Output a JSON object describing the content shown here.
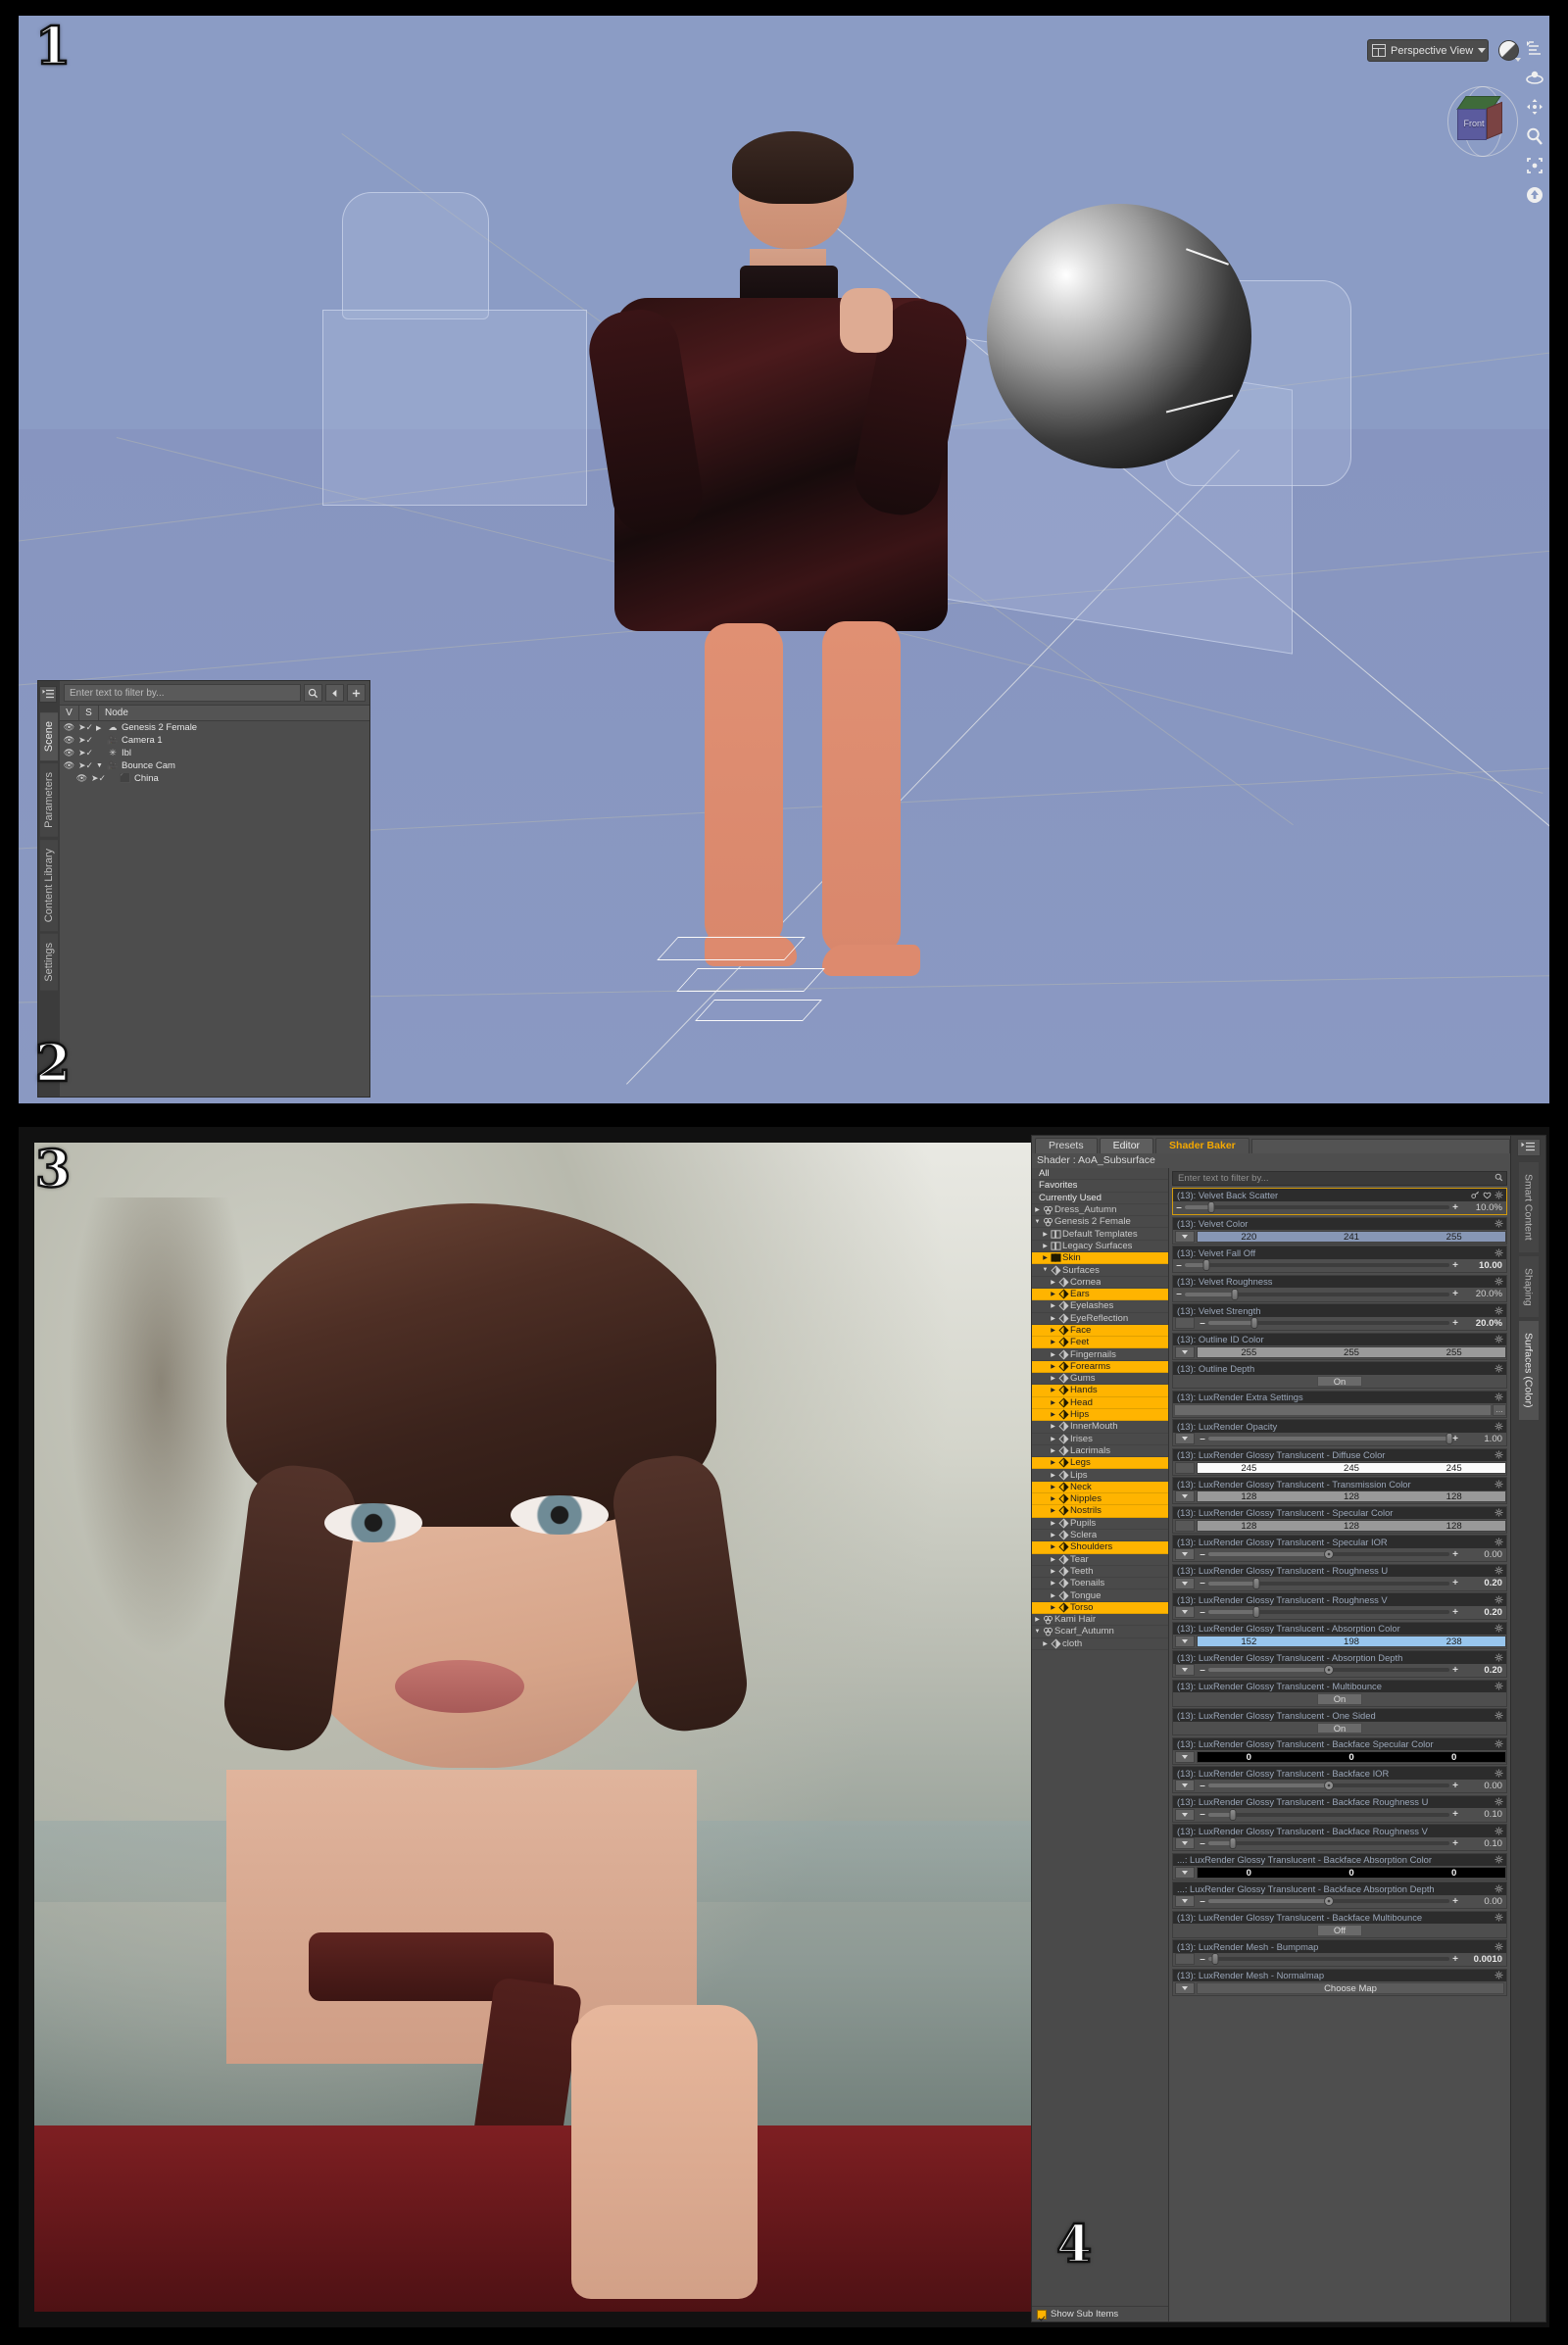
{
  "badges": {
    "b1": "1",
    "b2": "2",
    "b3": "3",
    "b4": "4"
  },
  "viewport": {
    "view_selector": "Perspective View",
    "cube_face": "Front",
    "tools": [
      "view-mode-icon",
      "orbit-icon",
      "pan-icon",
      "zoom-icon",
      "frame-icon",
      "reset-view-icon"
    ]
  },
  "scene_pane": {
    "tabs": [
      {
        "label": "Scene",
        "active": true
      },
      {
        "label": "Parameters",
        "active": false
      },
      {
        "label": "Content Library",
        "active": false
      },
      {
        "label": "Settings",
        "active": false
      }
    ],
    "filter_placeholder": "Enter text to filter by...",
    "columns": [
      "V",
      "S",
      "Node"
    ],
    "nodes": [
      {
        "name": "Genesis 2 Female",
        "icon": "figure-icon",
        "indent": 0,
        "expander": "▶"
      },
      {
        "name": "Camera 1",
        "icon": "camera-icon",
        "indent": 0,
        "expander": ""
      },
      {
        "name": "Ibl",
        "icon": "light-icon",
        "indent": 0,
        "expander": ""
      },
      {
        "name": "Bounce Cam",
        "icon": "camera-icon",
        "indent": 0,
        "expander": "▼"
      },
      {
        "name": "China",
        "icon": "cube-icon",
        "indent": 1,
        "expander": ""
      }
    ]
  },
  "surfaces": {
    "tabs": [
      {
        "label": "Presets",
        "state": "normal"
      },
      {
        "label": "Editor",
        "state": "active"
      },
      {
        "label": "Shader Baker",
        "state": "accent"
      }
    ],
    "shader_line": "Shader : AoA_Subsurface",
    "filter_placeholder": "Enter text to filter by...",
    "show_sub_items_label": "Show Sub Items",
    "show_sub_items_checked": true,
    "selected_color": "#ffb400",
    "tree": [
      {
        "label": "All",
        "type": "head",
        "depth": 0,
        "expander": "",
        "selected": false
      },
      {
        "label": "Favorites",
        "type": "head",
        "depth": 0,
        "expander": "",
        "selected": false
      },
      {
        "label": "Currently Used",
        "type": "head",
        "depth": 0,
        "expander": "",
        "selected": false
      },
      {
        "label": "Dress_Autumn",
        "type": "figure",
        "depth": 0,
        "expander": "▶",
        "selected": false
      },
      {
        "label": "Genesis 2 Female",
        "type": "figure",
        "depth": 0,
        "expander": "▼",
        "selected": false
      },
      {
        "label": "Default Templates",
        "type": "group",
        "depth": 1,
        "expander": "▶",
        "selected": false
      },
      {
        "label": "Legacy Surfaces",
        "type": "group",
        "depth": 1,
        "expander": "▶",
        "selected": false
      },
      {
        "label": "Skin",
        "type": "group",
        "depth": 1,
        "expander": "▶",
        "selected": true
      },
      {
        "label": "Surfaces",
        "type": "surf",
        "depth": 1,
        "expander": "▼",
        "selected": false
      },
      {
        "label": "Cornea",
        "type": "surf",
        "depth": 2,
        "expander": "▶",
        "selected": false
      },
      {
        "label": "Ears",
        "type": "surf",
        "depth": 2,
        "expander": "▶",
        "selected": true
      },
      {
        "label": "Eyelashes",
        "type": "surf",
        "depth": 2,
        "expander": "▶",
        "selected": false
      },
      {
        "label": "EyeReflection",
        "type": "surf",
        "depth": 2,
        "expander": "▶",
        "selected": false
      },
      {
        "label": "Face",
        "type": "surf",
        "depth": 2,
        "expander": "▶",
        "selected": true
      },
      {
        "label": "Feet",
        "type": "surf",
        "depth": 2,
        "expander": "▶",
        "selected": true
      },
      {
        "label": "Fingernails",
        "type": "surf",
        "depth": 2,
        "expander": "▶",
        "selected": false
      },
      {
        "label": "Forearms",
        "type": "surf",
        "depth": 2,
        "expander": "▶",
        "selected": true
      },
      {
        "label": "Gums",
        "type": "surf",
        "depth": 2,
        "expander": "▶",
        "selected": false
      },
      {
        "label": "Hands",
        "type": "surf",
        "depth": 2,
        "expander": "▶",
        "selected": true
      },
      {
        "label": "Head",
        "type": "surf",
        "depth": 2,
        "expander": "▶",
        "selected": true
      },
      {
        "label": "Hips",
        "type": "surf",
        "depth": 2,
        "expander": "▶",
        "selected": true
      },
      {
        "label": "InnerMouth",
        "type": "surf",
        "depth": 2,
        "expander": "▶",
        "selected": false
      },
      {
        "label": "Irises",
        "type": "surf",
        "depth": 2,
        "expander": "▶",
        "selected": false
      },
      {
        "label": "Lacrimals",
        "type": "surf",
        "depth": 2,
        "expander": "▶",
        "selected": false
      },
      {
        "label": "Legs",
        "type": "surf",
        "depth": 2,
        "expander": "▶",
        "selected": true
      },
      {
        "label": "Lips",
        "type": "surf",
        "depth": 2,
        "expander": "▶",
        "selected": false
      },
      {
        "label": "Neck",
        "type": "surf",
        "depth": 2,
        "expander": "▶",
        "selected": true
      },
      {
        "label": "Nipples",
        "type": "surf",
        "depth": 2,
        "expander": "▶",
        "selected": true
      },
      {
        "label": "Nostrils",
        "type": "surf",
        "depth": 2,
        "expander": "▶",
        "selected": true
      },
      {
        "label": "Pupils",
        "type": "surf",
        "depth": 2,
        "expander": "▶",
        "selected": false
      },
      {
        "label": "Sclera",
        "type": "surf",
        "depth": 2,
        "expander": "▶",
        "selected": false
      },
      {
        "label": "Shoulders",
        "type": "surf",
        "depth": 2,
        "expander": "▶",
        "selected": true
      },
      {
        "label": "Tear",
        "type": "surf",
        "depth": 2,
        "expander": "▶",
        "selected": false
      },
      {
        "label": "Teeth",
        "type": "surf",
        "depth": 2,
        "expander": "▶",
        "selected": false
      },
      {
        "label": "Toenails",
        "type": "surf",
        "depth": 2,
        "expander": "▶",
        "selected": false
      },
      {
        "label": "Tongue",
        "type": "surf",
        "depth": 2,
        "expander": "▶",
        "selected": false
      },
      {
        "label": "Torso",
        "type": "surf",
        "depth": 2,
        "expander": "▶",
        "selected": true
      },
      {
        "label": "Kami Hair",
        "type": "figure",
        "depth": 0,
        "expander": "▶",
        "selected": false
      },
      {
        "label": "Scarf_Autumn",
        "type": "figure",
        "depth": 0,
        "expander": "▼",
        "selected": false
      },
      {
        "label": "cloth",
        "type": "surf",
        "depth": 1,
        "expander": "▶",
        "selected": false
      }
    ],
    "properties": [
      {
        "title": "(13): Velvet Back Scatter",
        "kind": "slider",
        "highlight": true,
        "icons": [
          "key-icon",
          "heart-icon",
          "gear-icon"
        ],
        "value": "10.0%",
        "pos": 10,
        "bold": false,
        "knob": "pill",
        "lead": "none"
      },
      {
        "title": "(13): Velvet Color",
        "kind": "color",
        "lead": "drop",
        "channels": [
          "220",
          "241",
          "255"
        ],
        "color": "#8797b5",
        "dark": false
      },
      {
        "title": "(13): Velvet Fall Off",
        "kind": "slider",
        "value": "10.00",
        "pos": 8,
        "bold": true,
        "knob": "pill",
        "lead": "none"
      },
      {
        "title": "(13): Velvet Roughness",
        "kind": "slider",
        "value": "20.0%",
        "pos": 19,
        "bold": false,
        "knob": "pill",
        "lead": "none"
      },
      {
        "title": "(13): Velvet Strength",
        "kind": "slider",
        "value": "20.0%",
        "pos": 19,
        "bold": true,
        "knob": "pill",
        "lead": "blank"
      },
      {
        "title": "(13): Outline ID Color",
        "kind": "color",
        "lead": "drop",
        "channels": [
          "255",
          "255",
          "255"
        ],
        "color": "#9a9a9a",
        "dark": false
      },
      {
        "title": "(13): Outline Depth",
        "kind": "toggle",
        "value": "On"
      },
      {
        "title": "(13): LuxRender Extra Settings",
        "kind": "text",
        "value": ""
      },
      {
        "title": "(13): LuxRender Opacity",
        "kind": "slider",
        "value": "1.00",
        "pos": 100,
        "bold": false,
        "knob": "pill",
        "lead": "drop"
      },
      {
        "title": "(13): LuxRender Glossy Translucent - Diffuse Color",
        "kind": "color",
        "lead": "blank",
        "channels": [
          "245",
          "245",
          "245"
        ],
        "color": "#fbfbfb",
        "dark": false
      },
      {
        "title": "(13): LuxRender Glossy Translucent - Transmission Color",
        "kind": "color",
        "lead": "drop",
        "channels": [
          "128",
          "128",
          "128"
        ],
        "color": "#999999",
        "dark": false
      },
      {
        "title": "(13): LuxRender Glossy Translucent - Specular Color",
        "kind": "color",
        "lead": "blank",
        "channels": [
          "128",
          "128",
          "128"
        ],
        "color": "#999999",
        "dark": false
      },
      {
        "title": "(13): LuxRender Glossy Translucent - Specular IOR",
        "kind": "slider",
        "value": "0.00",
        "pos": 50,
        "bold": false,
        "knob": "round",
        "lead": "drop"
      },
      {
        "title": "(13): LuxRender Glossy Translucent - Roughness U",
        "kind": "slider",
        "value": "0.20",
        "pos": 20,
        "bold": true,
        "knob": "pill",
        "lead": "drop"
      },
      {
        "title": "(13): LuxRender Glossy Translucent - Roughness V",
        "kind": "slider",
        "value": "0.20",
        "pos": 20,
        "bold": true,
        "knob": "pill",
        "lead": "drop"
      },
      {
        "title": "(13): LuxRender Glossy Translucent - Absorption Color",
        "kind": "color",
        "lead": "drop",
        "channels": [
          "152",
          "198",
          "238"
        ],
        "color": "#98c6ee",
        "dark": false
      },
      {
        "title": "(13): LuxRender Glossy Translucent - Absorption Depth",
        "kind": "slider",
        "value": "0.20",
        "pos": 50,
        "bold": true,
        "knob": "round",
        "lead": "drop"
      },
      {
        "title": "(13): LuxRender Glossy Translucent - Multibounce",
        "kind": "toggle",
        "value": "On"
      },
      {
        "title": "(13): LuxRender Glossy Translucent - One Sided",
        "kind": "toggle",
        "value": "On"
      },
      {
        "title": "(13): LuxRender Glossy Translucent - Backface Specular Color",
        "kind": "color",
        "lead": "drop",
        "channels": [
          "0",
          "0",
          "0"
        ],
        "color": "#000000",
        "dark": true
      },
      {
        "title": "(13): LuxRender Glossy Translucent - Backface IOR",
        "kind": "slider",
        "value": "0.00",
        "pos": 50,
        "bold": false,
        "knob": "round",
        "lead": "drop"
      },
      {
        "title": "(13): LuxRender Glossy Translucent - Backface Roughness U",
        "kind": "slider",
        "value": "0.10",
        "pos": 10,
        "bold": false,
        "knob": "pill",
        "lead": "drop"
      },
      {
        "title": "(13): LuxRender Glossy Translucent - Backface Roughness V",
        "kind": "slider",
        "value": "0.10",
        "pos": 10,
        "bold": false,
        "knob": "pill",
        "lead": "drop"
      },
      {
        "title": "...: LuxRender Glossy Translucent - Backface Absorption Color",
        "kind": "color",
        "lead": "drop",
        "channels": [
          "0",
          "0",
          "0"
        ],
        "color": "#000000",
        "dark": true
      },
      {
        "title": "...: LuxRender Glossy Translucent - Backface Absorption Depth",
        "kind": "slider",
        "value": "0.00",
        "pos": 50,
        "bold": false,
        "knob": "round",
        "lead": "drop"
      },
      {
        "title": "(13): LuxRender Glossy Translucent - Backface Multibounce",
        "kind": "toggle",
        "value": "Off"
      },
      {
        "title": "(13): LuxRender Mesh - Bumpmap",
        "kind": "slider",
        "value": "0.0010",
        "pos": 3,
        "bold": true,
        "knob": "pill",
        "lead": "blank"
      },
      {
        "title": "(13): LuxRender Mesh - Normalmap",
        "kind": "choose",
        "value": "Choose Map"
      }
    ],
    "right_tabs": [
      {
        "label": "Smart Content",
        "active": false
      },
      {
        "label": "Shaping",
        "active": false
      },
      {
        "label": "Surfaces (Color)",
        "active": true
      }
    ]
  }
}
